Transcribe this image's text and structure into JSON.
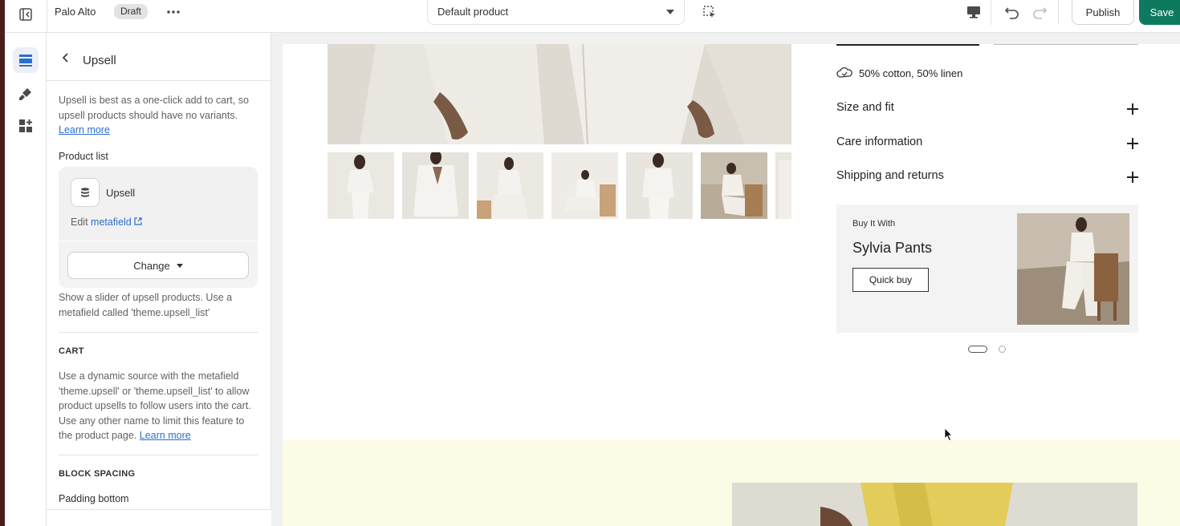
{
  "topbar": {
    "theme_name": "Palo Alto",
    "status_badge": "Draft",
    "template_select": "Default product",
    "publish_label": "Publish",
    "save_label": "Save"
  },
  "rail": {
    "items": [
      {
        "icon": "sections-icon",
        "active": true
      },
      {
        "icon": "theme-settings-brush-icon",
        "active": false
      },
      {
        "icon": "apps-blocks-icon",
        "active": false
      }
    ]
  },
  "panel": {
    "title": "Upsell",
    "intro_text": "Upsell is best as a one-click add to cart, so upsell products should have no variants.",
    "intro_link": "Learn more",
    "product_list_label": "Product list",
    "product_name": "Upsell",
    "edit_prefix": "Edit",
    "edit_link": "metafield",
    "change_label": "Change",
    "slider_help": "Show a slider of upsell products. Use a metafield called 'theme.upsell_list'",
    "cart_heading": "CART",
    "cart_text": "Use a dynamic source with the metafield 'theme.upsell' or 'theme.upsell_list' to allow product upsells to follow users into the cart. Use any other name to limit this feature to the product page.",
    "cart_link": "Learn more",
    "spacing_heading": "BLOCK SPACING",
    "padding_label": "Padding bottom"
  },
  "preview": {
    "material_text": "50% cotton, 50% linen",
    "accordions": [
      {
        "label": "Size and fit"
      },
      {
        "label": "Care information"
      },
      {
        "label": "Shipping and returns"
      }
    ],
    "upsell": {
      "kicker": "Buy It With",
      "title": "Sylvia Pants",
      "button": "Quick buy"
    },
    "colors": {
      "accent_green": "#0d7a5f",
      "yellow_band": "#fbfbe6"
    }
  }
}
